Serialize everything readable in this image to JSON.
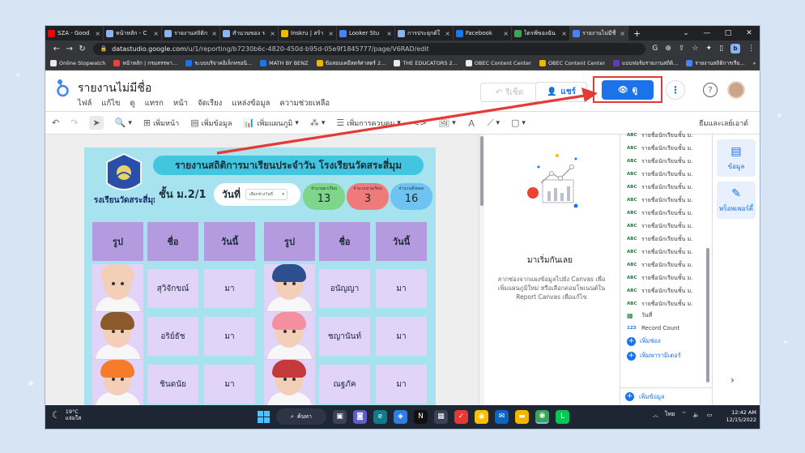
{
  "browser": {
    "tabs": [
      {
        "label": "SZA - Good",
        "icon": "youtube-icon",
        "color": "#ff0000"
      },
      {
        "label": "หน้าหลัก - C",
        "icon": "chrome-page-icon",
        "color": "#8ab4f8"
      },
      {
        "label": "รายงานสถิติก",
        "icon": "chrome-page-icon",
        "color": "#8ab4f8"
      },
      {
        "label": "สำนวนของ ร",
        "icon": "chrome-page-icon",
        "color": "#8ab4f8"
      },
      {
        "label": "Inskru | สร้า",
        "icon": "inskru-icon",
        "color": "#f4b400"
      },
      {
        "label": "Looker Stu",
        "icon": "looker-icon",
        "color": "#4285f4"
      },
      {
        "label": "การประยุกต์ใ",
        "icon": "chrome-page-icon",
        "color": "#8ab4f8"
      },
      {
        "label": "Facebook",
        "icon": "facebook-icon",
        "color": "#1877f2"
      },
      {
        "label": "ไดรฟ์ของฉัน",
        "icon": "drive-icon",
        "color": "#34a853"
      },
      {
        "label": "รายงานไม่มีชื่",
        "icon": "looker-icon",
        "color": "#4285f4"
      }
    ],
    "url_host": "datastudio.google.com",
    "url_path": "/u/1/reporting/b7230b6c-4820-450d-b95d-05e9f1845777/page/V6RAD/edit",
    "profile_letter": "b",
    "bookmarks": [
      {
        "label": "Online Stopwatch",
        "color": "#e8eaed"
      },
      {
        "label": "หน้าหลัก | กรมสรรพา...",
        "color": "#ea4335"
      },
      {
        "label": "ระบบบริจาคอิเล็กทรอนิ...",
        "color": "#1a73e8"
      },
      {
        "label": "MATH BY BENZ",
        "color": "#1877f2"
      },
      {
        "label": "ข้อสอบเคมีสตร์ศาสตร์ 2...",
        "color": "#f4b400"
      },
      {
        "label": "THE EDUCATORS 2...",
        "color": "#e8eaed"
      },
      {
        "label": "OBEC Content Center",
        "color": "#e8eaed"
      },
      {
        "label": "OBEC Content Center",
        "color": "#f4b400"
      },
      {
        "label": "แบบฟอร์มรายงานสถิติ...",
        "color": "#673ab7"
      },
      {
        "label": "รายงานสถิติการเรีย...",
        "color": "#4285f4"
      }
    ]
  },
  "header": {
    "title": "รายงานไม่มีชื่อ",
    "menu": [
      "ไฟล์",
      "แก้ไข",
      "ดู",
      "แทรก",
      "หน้า",
      "จัดเรียง",
      "แหล่งข้อมูล",
      "ความช่วยเหลือ"
    ],
    "reset_label": "รีเซ็ต",
    "share_label": "แชร์",
    "view_label": "ดู"
  },
  "toolbar": {
    "add_page": "เพิ่มหน้า",
    "add_data": "เพิ่มข้อมูล",
    "add_chart": "เพิ่มแผนภูมิ",
    "add_control": "เพิ่มการควบคุม",
    "theme_layout": "ธีมและเลย์เอาต์"
  },
  "report": {
    "banner_title": "รายงานสถิติการมาเรียนประจำวัน โรงเรียนวัดสระสี่มุม",
    "school_name": "โรงเรียนวัดสระสี่มุม",
    "class_label": "ชั้น ม.2/1",
    "date_label": "วันที่",
    "date_select": "เลือกช่วงวันที่",
    "stats": [
      {
        "label": "จำนวนมาเรียน",
        "value": "13",
        "color": "#7dd68a"
      },
      {
        "label": "จำนวนขาดเรียน",
        "value": "3",
        "color": "#f07a7a"
      },
      {
        "label": "จำนวนทั้งหมด",
        "value": "16",
        "color": "#6ec3f2"
      }
    ],
    "headers": [
      "รูป",
      "ชื่อ",
      "วันนี้",
      "รูป",
      "ชื่อ",
      "วันนี้"
    ],
    "left_rows": [
      {
        "name": "สุวิจักขณ์",
        "status": "มา",
        "hair": "#f2cfb6"
      },
      {
        "name": "อริย์ธัช",
        "status": "มา",
        "hair": "#8b5a2b"
      },
      {
        "name": "ชินดนัย",
        "status": "มา",
        "hair": "#f57c2a"
      }
    ],
    "right_rows": [
      {
        "name": "อนัญญา",
        "status": "มา",
        "hair": "#2c4f8f"
      },
      {
        "name": "ชญานันท์",
        "status": "มา",
        "hair": "#f48fa0"
      },
      {
        "name": "ณฐภัค",
        "status": "มา",
        "hair": "#c43a3a"
      }
    ]
  },
  "get_started": {
    "title": "มาเริ่มกันเลย",
    "description": "ลากช่องจากแผงข้อมูลไปยัง Canvas เพื่อเพิ่มแผนภูมิใหม่ หรือเลือกคอมโพเนนต์ใน Report Canvas เพื่อแก้ไข"
  },
  "fields": {
    "items": [
      {
        "type": "ABC",
        "label": "รายชื่อนักเรียนชั้น ม."
      },
      {
        "type": "ABC",
        "label": "รายชื่อนักเรียนชั้น ม."
      },
      {
        "type": "ABC",
        "label": "รายชื่อนักเรียนชั้น ม."
      },
      {
        "type": "ABC",
        "label": "รายชื่อนักเรียนชั้น ม."
      },
      {
        "type": "ABC",
        "label": "รายชื่อนักเรียนชั้น ม."
      },
      {
        "type": "ABC",
        "label": "รายชื่อนักเรียนชั้น ม."
      },
      {
        "type": "ABC",
        "label": "รายชื่อนักเรียนชั้น ม."
      },
      {
        "type": "ABC",
        "label": "รายชื่อนักเรียนชั้น ม."
      },
      {
        "type": "ABC",
        "label": "รายชื่อนักเรียนชั้น ม."
      },
      {
        "type": "ABC",
        "label": "รายชื่อนักเรียนชั้น ม."
      },
      {
        "type": "ABC",
        "label": "รายชื่อนักเรียนชั้น ม."
      },
      {
        "type": "ABC",
        "label": "รายชื่อนักเรียนชั้น ม."
      },
      {
        "type": "ABC",
        "label": "รายชื่อนักเรียนชั้น ม."
      },
      {
        "type": "ABC",
        "label": "รายชื่อนักเรียนชั้น ม."
      }
    ],
    "date_field": "วันที่",
    "count_type": "123",
    "count_field": "Record Count",
    "add_field": "เพิ่มช่อง",
    "add_parameter": "เพิ่มพารามิเตอร์",
    "add_data": "เพิ่มข้อมูล"
  },
  "rail": {
    "data_label": "ข้อมูล",
    "properties_label": "พร็อพเพอร์ตี้"
  },
  "taskbar": {
    "temp": "19°C",
    "weather_desc": "แจ่มใส",
    "search_label": "ค้นหา",
    "lang": "ไทย",
    "time": "12:42 AM",
    "date": "12/15/2022"
  },
  "colors": {
    "accent": "#1a73e8",
    "highlight": "#e53935",
    "report_bg": "#a6e3ef",
    "banner": "#42c6e0",
    "header_cell": "#b49be0",
    "body_cell": "#e2d3f9"
  }
}
